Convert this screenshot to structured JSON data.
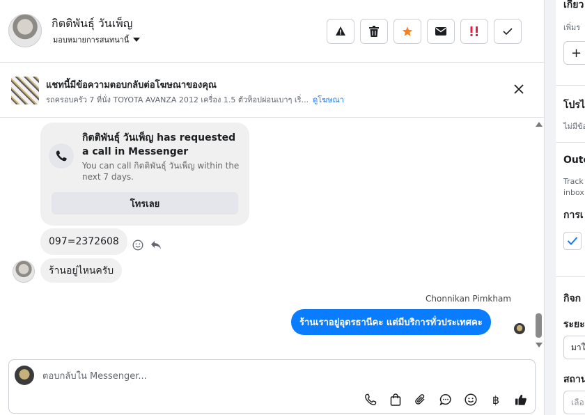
{
  "header": {
    "contact_name": "กิตติพันธุ์ วันเพ็ญ",
    "assign_label": "มอบหมายการสนทนานี้"
  },
  "toolbar": {
    "buttons": [
      {
        "name": "flag-alert",
        "icon": "warning-icon"
      },
      {
        "name": "delete",
        "icon": "trash-icon"
      },
      {
        "name": "star",
        "icon": "star-icon",
        "color": "#f5821f"
      },
      {
        "name": "mark-unread",
        "icon": "envelope-icon"
      },
      {
        "name": "spam",
        "icon": "spam-icon",
        "color": "#e41e3f"
      },
      {
        "name": "mark-done",
        "icon": "check-icon"
      }
    ]
  },
  "ad_context": {
    "title": "แชทนี้มีข้อความตอบกลับต่อโฆษณาของคุณ",
    "description": "รถครอบครัว 7 ที่นั่ง TOYOTA AVANZA 2012 เครื่อง 1.5 ตัวท็อปผ่อนเบาๆ เริ่...",
    "link_label": "ดูโฆษณา"
  },
  "messages": {
    "call_request": {
      "title": "กิตติพันธุ์ วันเพ็ญ has requested a call in Messenger",
      "subtitle": "You can call กิตติพันธุ์ วันเพ็ญ within the next 7 days.",
      "button_label": "โทรเลย"
    },
    "incoming": [
      {
        "text": "097=2372608"
      },
      {
        "text": "ร้านอยู่ไหนครับ"
      }
    ],
    "outgoing": {
      "sender": "Chonnikan Pimkham",
      "text": "ร้านเราอยู่อุดรธานีคะ แต่มีบริการทั่วประเทศคะ"
    }
  },
  "composer": {
    "placeholder": "ตอบกลับใน Messenger...",
    "tools": [
      "phone-icon",
      "shopping-bag-icon",
      "paperclip-icon",
      "chat-bubble-icon",
      "emoji-icon",
      "baht-icon",
      "thumbs-up-icon"
    ],
    "baht_symbol": "฿"
  },
  "sidebar": {
    "section1_title": "เกี่ยว",
    "section1_text": "เพิ่มร",
    "add_symbol": "+",
    "section2_title": "โปรไ",
    "section2_text": "ไม่มีข้อ",
    "section3_title": "Outc",
    "section3_text1": "Track",
    "section3_text2": "inbox",
    "section3_label": "การเ",
    "section4_title": "กิจก",
    "field1_label": "ระยะ",
    "field1_value": "มาใ",
    "field2_label": "สถาน",
    "field2_value": "เลือ"
  },
  "colors": {
    "accent": "#0a7cff",
    "link": "#1877f2",
    "star": "#f5821f",
    "spam": "#e41e3f"
  }
}
